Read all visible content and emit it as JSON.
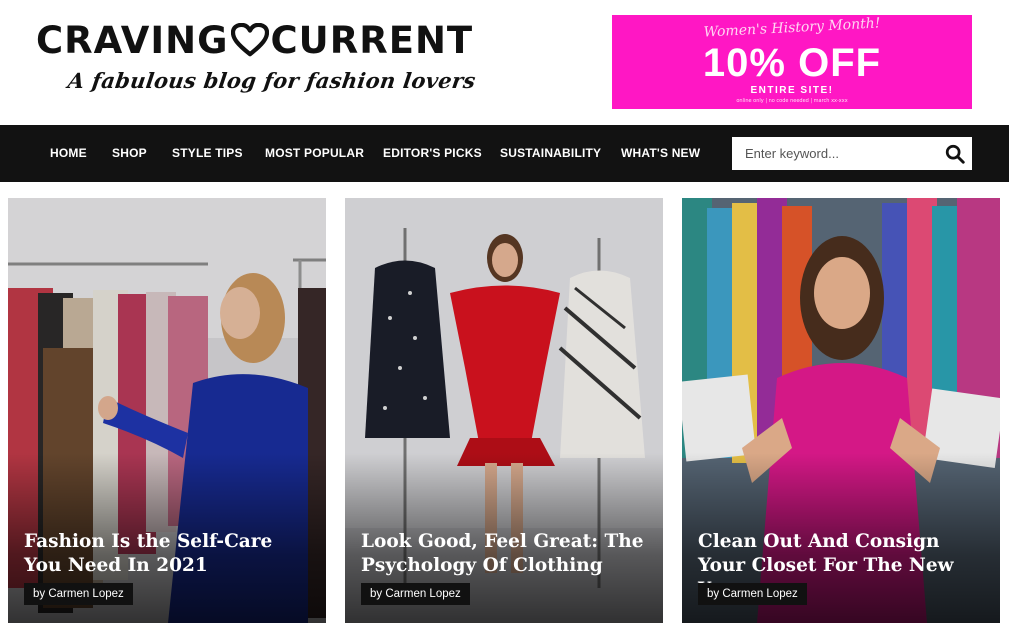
{
  "site": {
    "logo_left": "CRAVING",
    "logo_right": "CURRENT",
    "tagline": "A fabulous blog for fashion lovers"
  },
  "promo": {
    "top_line": "Women's History Month!",
    "headline": "10% OFF",
    "subline": "ENTIRE SITE!",
    "fine_print": "online only | no code needed | march xx-xxx"
  },
  "nav": {
    "items": [
      {
        "label": "HOME"
      },
      {
        "label": "SHOP"
      },
      {
        "label": "STYLE TIPS"
      },
      {
        "label": "MOST POPULAR"
      },
      {
        "label": "EDITOR'S PICKS"
      },
      {
        "label": "SUSTAINABILITY"
      },
      {
        "label": "WHAT'S NEW"
      }
    ]
  },
  "search": {
    "placeholder": "Enter keyword...",
    "icon": "search-icon"
  },
  "posts": [
    {
      "title": "Fashion Is the Self-Care You Need In 2021",
      "author": "by Carmen Lopez"
    },
    {
      "title": "Look Good, Feel Great: The Psychology Of Clothing",
      "author": "by Carmen Lopez"
    },
    {
      "title": "Clean Out And Consign Your Closet For The New Year",
      "author": "by Carmen Lopez"
    }
  ],
  "colors": {
    "nav_bg": "#121212",
    "promo_bg": "#ff17c4",
    "text_dark": "#111111"
  }
}
